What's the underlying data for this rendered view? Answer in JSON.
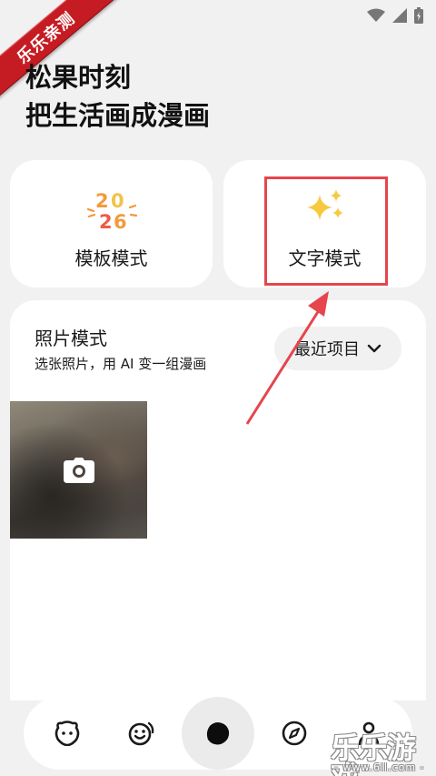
{
  "ribbon": {
    "text": "乐乐亲测"
  },
  "header": {
    "line1": "松果时刻",
    "line2": "把生活画成漫画"
  },
  "modes": {
    "template": {
      "label": "模板模式",
      "icon": "2026-sticker-icon"
    },
    "text": {
      "label": "文字模式",
      "icon": "sparkles-icon"
    }
  },
  "photo_mode": {
    "title": "照片模式",
    "subtitle": "选张照片，用 AI 变一组漫画",
    "recent_button": "最近项目",
    "camera_icon": "camera-icon"
  },
  "nav": {
    "items": [
      {
        "icon": "pet-face-icon"
      },
      {
        "icon": "smile-face-icon"
      },
      {
        "icon": "pinecone-icon",
        "active": true
      },
      {
        "icon": "compass-icon"
      },
      {
        "icon": "profile-icon"
      }
    ]
  },
  "watermark": {
    "text": "乐乐游戏",
    "url": "- www.6ll.com -"
  },
  "colors": {
    "accent_red": "#e6454d",
    "ribbon_red": "#c51b22",
    "background": "#f1f1f1"
  }
}
